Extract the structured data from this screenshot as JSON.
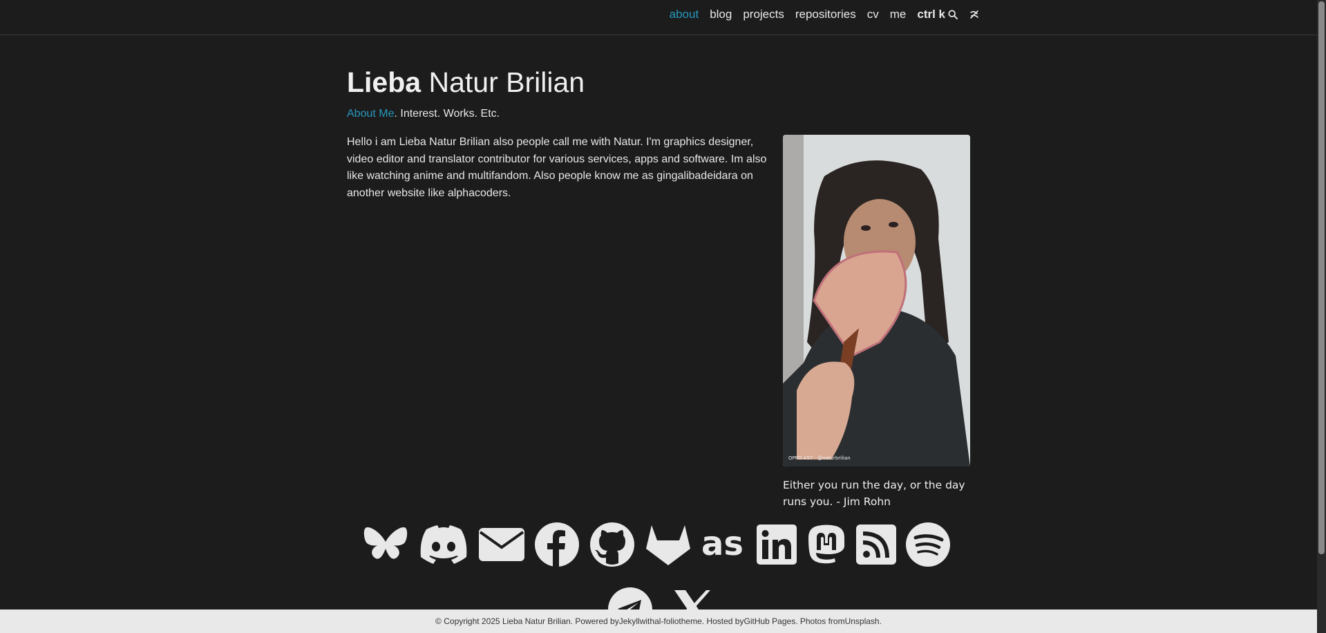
{
  "nav": {
    "items": [
      {
        "label": "about",
        "active": true
      },
      {
        "label": "blog"
      },
      {
        "label": "projects"
      },
      {
        "label": "repositories"
      },
      {
        "label": "cv"
      },
      {
        "label": "me"
      }
    ],
    "search_label": "ctrl k",
    "search_icon": "search-icon",
    "theme_icon": "theme-toggle-icon"
  },
  "header": {
    "first_name": "Lieba",
    "rest_name": " Natur Brilian",
    "desc_link": "About Me",
    "desc_rest": ". Interest. Works. Etc."
  },
  "bio": "Hello i am Lieba Natur Brilian also people call me with Natur. I'm graphics designer, video editor and translator contributor for various services, apps and software. Im also like watching anime and multifandom. Also people know me as gingalibadeidara on another website like alphacoders.",
  "profile": {
    "watermark": "OPPO A57 · @naturbrilian"
  },
  "quote": "Either you run the day, or the day runs you. - Jim Rohn",
  "socials": [
    "bluesky-icon",
    "discord-icon",
    "email-icon",
    "facebook-icon",
    "github-icon",
    "gitlab-icon",
    "lastfm-icon",
    "linkedin-icon",
    "mastodon-icon",
    "rss-icon",
    "spotify-icon",
    "telegram-icon",
    "x-twitter-icon"
  ],
  "footer": {
    "prefix": "© Copyright 2025 Lieba Natur Brilian. Powered by ",
    "jekyll": "Jekyll",
    "with": " with ",
    "alfolio": "al-folio",
    "theme": " theme. Hosted by ",
    "github_pages": "GitHub Pages",
    "photos": ". Photos from ",
    "unsplash": "Unsplash",
    "end": "."
  },
  "colors": {
    "background": "#1c1c1d",
    "accent": "#2698ba",
    "footer_bg": "#e9e9e9"
  }
}
